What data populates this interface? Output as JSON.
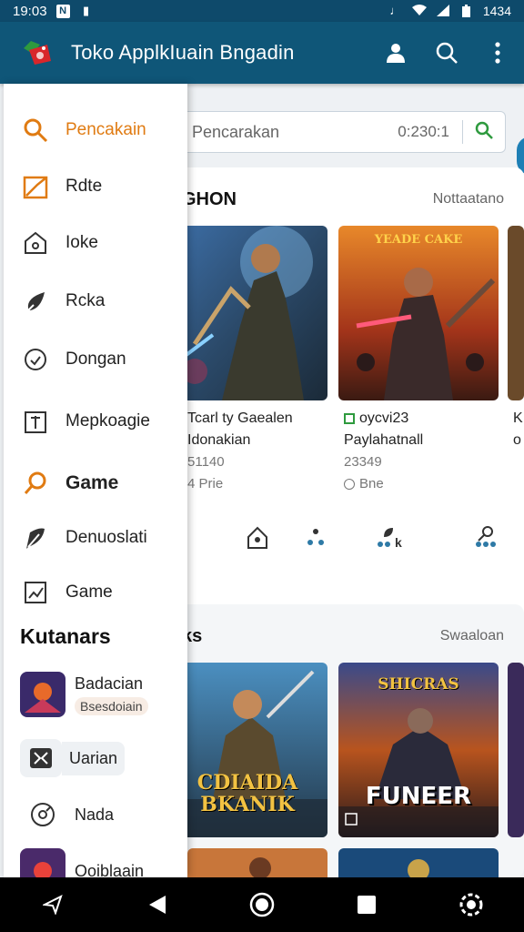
{
  "status_bar": {
    "time": "19:03",
    "battery_text": "1434"
  },
  "app_bar": {
    "title": "Toko ApplkIuain Bngadin"
  },
  "search": {
    "placeholder": "Pencarakan",
    "code": "0:230:1"
  },
  "drawer": {
    "items": [
      {
        "label": "Pencakain",
        "icon": "search-icon",
        "active": true
      },
      {
        "label": "Rdte",
        "icon": "trending-icon"
      },
      {
        "label": "Ioke",
        "icon": "home-icon"
      },
      {
        "label": "Rcka",
        "icon": "rocket-icon"
      },
      {
        "label": "Dongan",
        "icon": "clock-icon"
      },
      {
        "label": "Mepkoagie",
        "icon": "book-icon"
      },
      {
        "label": "Game",
        "icon": "game-search-icon",
        "bold": true
      },
      {
        "label": "Denuoslati",
        "icon": "leaf-icon"
      },
      {
        "label": "Game",
        "icon": "chart-icon"
      }
    ],
    "category_heading": "Kutanars",
    "categories": [
      {
        "label": "Badacian",
        "badge": "Bsesdoiain"
      },
      {
        "label": "Uarian"
      },
      {
        "label": "Nada"
      },
      {
        "label": "Ooiblaain"
      }
    ]
  },
  "section1": {
    "title": "GHON",
    "link": "Nottaatano"
  },
  "section1_games": [
    {
      "title": "Tcarl ty Gaealen",
      "subtitle": "Idonakian",
      "count": "51140",
      "meta": "4 Prie"
    },
    {
      "title": "oycvi23",
      "subtitle": "Paylahatnall",
      "count": "23349",
      "meta": "Bne",
      "banner": "YEADE CAKE"
    },
    {
      "title": "K",
      "subtitle": "o",
      "count": "",
      "meta": ""
    }
  ],
  "section2": {
    "title": "ks",
    "link": "Swaaloan"
  },
  "section2_games": [
    {
      "banner": "CDIAIDA BKANIK"
    },
    {
      "banner": "FUNEER",
      "top_banner": "SHICRAS"
    }
  ],
  "icon_row": [
    "shop-icon",
    "dots-icon",
    "pin-k-icon",
    "key-icon"
  ],
  "icon_row_text": "k",
  "colors": {
    "primary": "#0f5678",
    "accent": "#e07b12",
    "status": "#0e4a6b"
  }
}
